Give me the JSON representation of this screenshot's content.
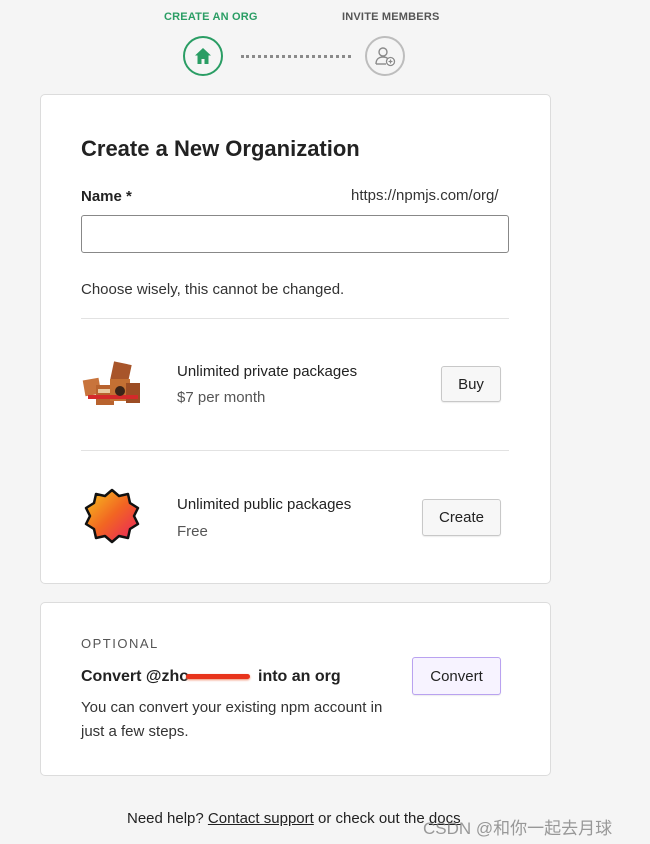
{
  "stepper": {
    "step1_label": "CREATE AN ORG",
    "step2_label": "INVITE MEMBERS",
    "active_color": "#2a9d64",
    "inactive_color": "#888888"
  },
  "create_card": {
    "title": "Create a New Organization",
    "name_label": "Name *",
    "url_prefix": "https://npmjs.com/org/",
    "name_value": "",
    "hint": "Choose wisely, this cannot be changed.",
    "plans": [
      {
        "title": "Unlimited private packages",
        "price": "$7 per month",
        "button": "Buy",
        "icon": "boxes-icon"
      },
      {
        "title": "Unlimited public packages",
        "price": "Free",
        "button": "Create",
        "icon": "badge-icon"
      }
    ]
  },
  "convert_card": {
    "eyebrow": "OPTIONAL",
    "title_prefix": "Convert @zho",
    "title_suffix": "into an org",
    "description_line1": "You can convert your existing npm account in",
    "description_line2": "just a few steps.",
    "button": "Convert",
    "button_accent": "#8b5cf6"
  },
  "footer": {
    "help_prefix": "Need help?",
    "contact_link": "Contact support",
    "help_middle": "or check out the",
    "docs_link": "docs",
    "watermark": "CSDN @和你一起去月球"
  }
}
